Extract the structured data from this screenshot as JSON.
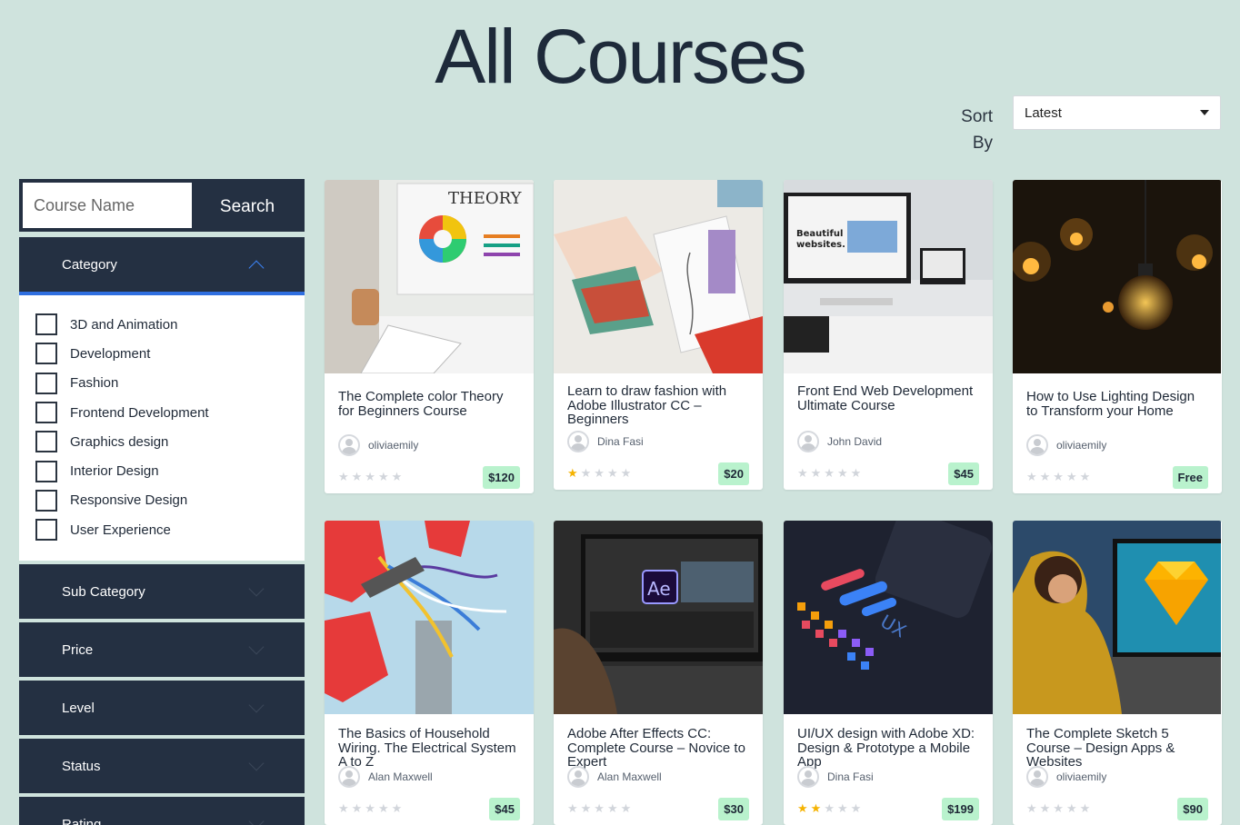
{
  "title": "All Courses",
  "sort": {
    "label": "Sort By",
    "selected": "Latest"
  },
  "search": {
    "placeholder": "Course Name",
    "button": "Search"
  },
  "filters": {
    "category": {
      "label": "Category",
      "items": [
        "3D and Animation",
        "Development",
        "Fashion",
        "Frontend Development",
        "Graphics design",
        "Interior Design",
        "Responsive Design",
        "User Experience"
      ]
    },
    "collapsed": [
      "Sub Category",
      "Price",
      "Level",
      "Status",
      "Rating"
    ]
  },
  "courses": [
    {
      "title": "The Complete color Theory for Beginners Course",
      "author": "oliviaemily",
      "rating": 0,
      "price": "$120",
      "thumb_icon": "color-wheel-monitor"
    },
    {
      "title": "Learn to draw fashion with Adobe Illustrator CC – Beginners",
      "author": "Dina Fasi",
      "rating": 1,
      "price": "$20",
      "thumb_icon": "fashion-sketch"
    },
    {
      "title": "Front End Web Development Ultimate Course",
      "author": "John David",
      "rating": 0,
      "price": "$45",
      "thumb_icon": "web-monitor"
    },
    {
      "title": "How to Use Lighting Design to Transform your Home",
      "author": "oliviaemily",
      "rating": 0,
      "price": "Free",
      "thumb_icon": "light-bulbs"
    },
    {
      "title": "The Basics of Household Wiring. The Electrical System A to Z",
      "author": "Alan Maxwell",
      "rating": 0,
      "price": "$45",
      "thumb_icon": "wires"
    },
    {
      "title": "Adobe After Effects CC: Complete Course – Novice to Expert",
      "author": "Alan Maxwell",
      "rating": 0,
      "price": "$30",
      "thumb_icon": "after-effects"
    },
    {
      "title": "UI/UX design with Adobe XD: Design & Prototype a Mobile App",
      "author": "Dina Fasi",
      "rating": 2,
      "price": "$199",
      "thumb_icon": "ux-phone"
    },
    {
      "title": "The Complete Sketch 5 Course – Design Apps & Websites",
      "author": "oliviaemily",
      "rating": 0,
      "price": "$90",
      "thumb_icon": "sketch-logo"
    }
  ],
  "colors": {
    "sidebar": "#243042",
    "accent": "#2f6fe0",
    "background": "#cfe3dd",
    "price_badge": "#b9f2cd",
    "star": "#f5b301"
  }
}
